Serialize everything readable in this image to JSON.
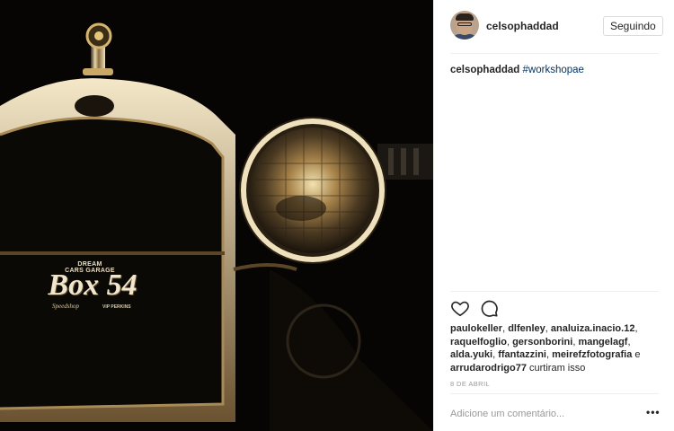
{
  "photo": {
    "alt_icon": "vintage-car-photo",
    "plate": {
      "line1": "DREAM",
      "line2": "CARS GARAGE",
      "main": "Box 54",
      "sub": "Speedshop",
      "small": "VIP PERKINS"
    }
  },
  "header": {
    "username": "celsophaddad",
    "follow_label": "Seguindo"
  },
  "caption": {
    "username": "celsophaddad",
    "hashtag": "#workshopae"
  },
  "actions": {
    "like_icon": "heart-icon",
    "comment_icon": "comment-icon"
  },
  "likes": {
    "users": [
      "paulokeller",
      "dlfenley",
      "analuiza.inacio.12",
      "raquelfoglio",
      "gersonborini",
      "mangelagf",
      "alda.yuki",
      "ffantazzini",
      "meirefzfotografia",
      "arrudarodrigo77"
    ],
    "sep1": ", ",
    "sep2": ", ",
    "sep3": ", ",
    "sep4": ", ",
    "sep5": ", ",
    "sep6": ", ",
    "sep7": ", ",
    "sep8": ", ",
    "and": " e ",
    "suffix": " curtiram isso"
  },
  "date": "8 DE ABRIL",
  "comment": {
    "placeholder": "Adicione um comentário...",
    "more_label": "•••"
  },
  "colors": {
    "link": "#003569",
    "muted": "#999999",
    "border": "#efefef"
  }
}
